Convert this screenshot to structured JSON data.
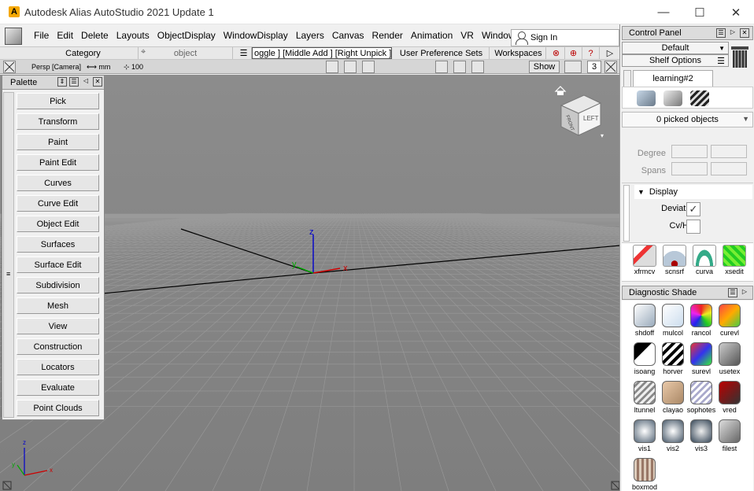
{
  "window": {
    "title": "Autodesk Alias AutoStudio 2021 Update 1",
    "logo_letter": "A",
    "minimize": "—",
    "maximize": "☐",
    "close": "✕"
  },
  "menubar": {
    "object_label": "object",
    "items": [
      "File",
      "Edit",
      "Delete",
      "Layouts",
      "ObjectDisplay",
      "WindowDisplay",
      "Layers",
      "Canvas",
      "Render",
      "Animation",
      "VR",
      "Windows"
    ],
    "sign_in": "Sign In"
  },
  "shelfbar": {
    "category": "Category",
    "object": "object",
    "hotkeys": "oggle ] [Middle Add ] [Right Unpick ]",
    "user_pref": "User Preference Sets",
    "workspaces": "Workspaces"
  },
  "vptoolbar": {
    "camera": "Persp [Camera]",
    "units": "mm",
    "grid_value": "100",
    "show_label": "Show",
    "number": "3"
  },
  "viewcube": {
    "face_label": "LEFT",
    "side_label": "FRONT"
  },
  "axes": {
    "x": "x",
    "y": "y",
    "z": "z"
  },
  "corner_axes": {
    "x": "x",
    "y": "y",
    "z": "z"
  },
  "palette": {
    "title": "Palette",
    "items": [
      "Pick",
      "Transform",
      "Paint",
      "Paint Edit",
      "Curves",
      "Curve Edit",
      "Object Edit",
      "Surfaces",
      "Surface Edit",
      "Subdivision",
      "Mesh",
      "View",
      "Construction",
      "Locators",
      "Evaluate",
      "Point Clouds"
    ]
  },
  "control_panel": {
    "title": "Control Panel",
    "layout_value": "Default",
    "shelf_options": "Shelf Options",
    "shelf_tab": "learning#2",
    "picked": "0 picked objects",
    "degree_label": "Degree",
    "spans_label": "Spans",
    "display_label": "Display",
    "deviation_label": "Deviation",
    "cvhull_label": "Cv/Hull",
    "deviation_checked": "✓",
    "tools": [
      "xfrmcv",
      "scnsrf",
      "curva",
      "xsedit"
    ]
  },
  "diagnostic_shade": {
    "title": "Diagnostic Shade",
    "items": [
      "shdoff",
      "mulcol",
      "rancol",
      "curevl",
      "isoang",
      "horver",
      "surevl",
      "usetex",
      "ltunnel",
      "clayao",
      "sophotes",
      "vred",
      "vis1",
      "vis2",
      "vis3",
      "filest",
      "boxmod"
    ]
  },
  "colors": {
    "viewport_bg": "#888888",
    "grid_line": "#9a9a9a",
    "axis_x": "#cc0000",
    "axis_y": "#00aa00",
    "axis_z": "#0000cc"
  }
}
